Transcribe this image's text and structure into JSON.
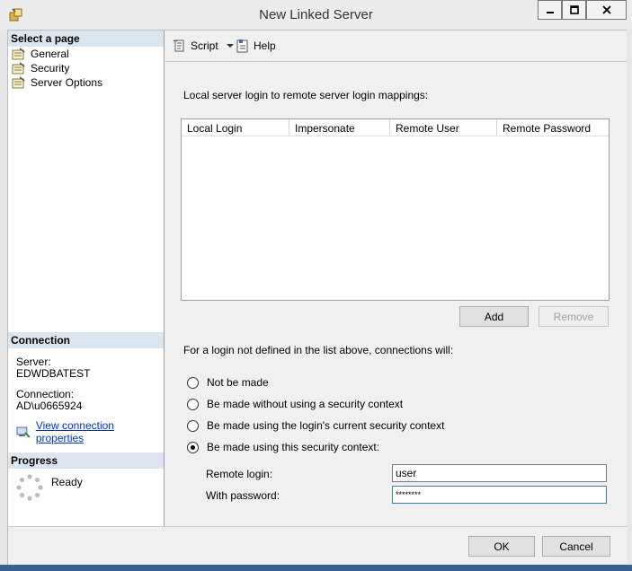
{
  "window": {
    "title": "New Linked Server"
  },
  "sidebar": {
    "select_page_header": "Select a page",
    "pages": [
      {
        "label": "General"
      },
      {
        "label": "Security"
      },
      {
        "label": "Server Options"
      }
    ],
    "connection_header": "Connection",
    "server_label": "Server:",
    "server_value": "EDWDBATEST",
    "connection_label": "Connection:",
    "connection_value": "AD\\u0665924",
    "view_connection_link": "View connection properties",
    "progress_header": "Progress",
    "progress_status": "Ready"
  },
  "toolbar": {
    "script_label": "Script",
    "help_label": "Help"
  },
  "security": {
    "mappings_caption": "Local server login to remote server login mappings:",
    "columns": [
      "Local Login",
      "Impersonate",
      "Remote User",
      "Remote Password"
    ],
    "add_label": "Add",
    "remove_label": "Remove",
    "undefined_caption": "For a login not defined in the list above, connections will:",
    "options": [
      {
        "label": "Not be made",
        "selected": false
      },
      {
        "label": "Be made without using a security context",
        "selected": false
      },
      {
        "label": "Be made using the login's current security context",
        "selected": false
      },
      {
        "label": "Be made using this security context:",
        "selected": true
      }
    ],
    "remote_login_label": "Remote login:",
    "remote_login_value": "user",
    "password_label": "With password:",
    "password_value": "********"
  },
  "footer": {
    "ok_label": "OK",
    "cancel_label": "Cancel"
  },
  "colors": {
    "section_header_bg": "#dce6f0",
    "link": "#0033cc",
    "focus_border": "#3c7fb1"
  }
}
